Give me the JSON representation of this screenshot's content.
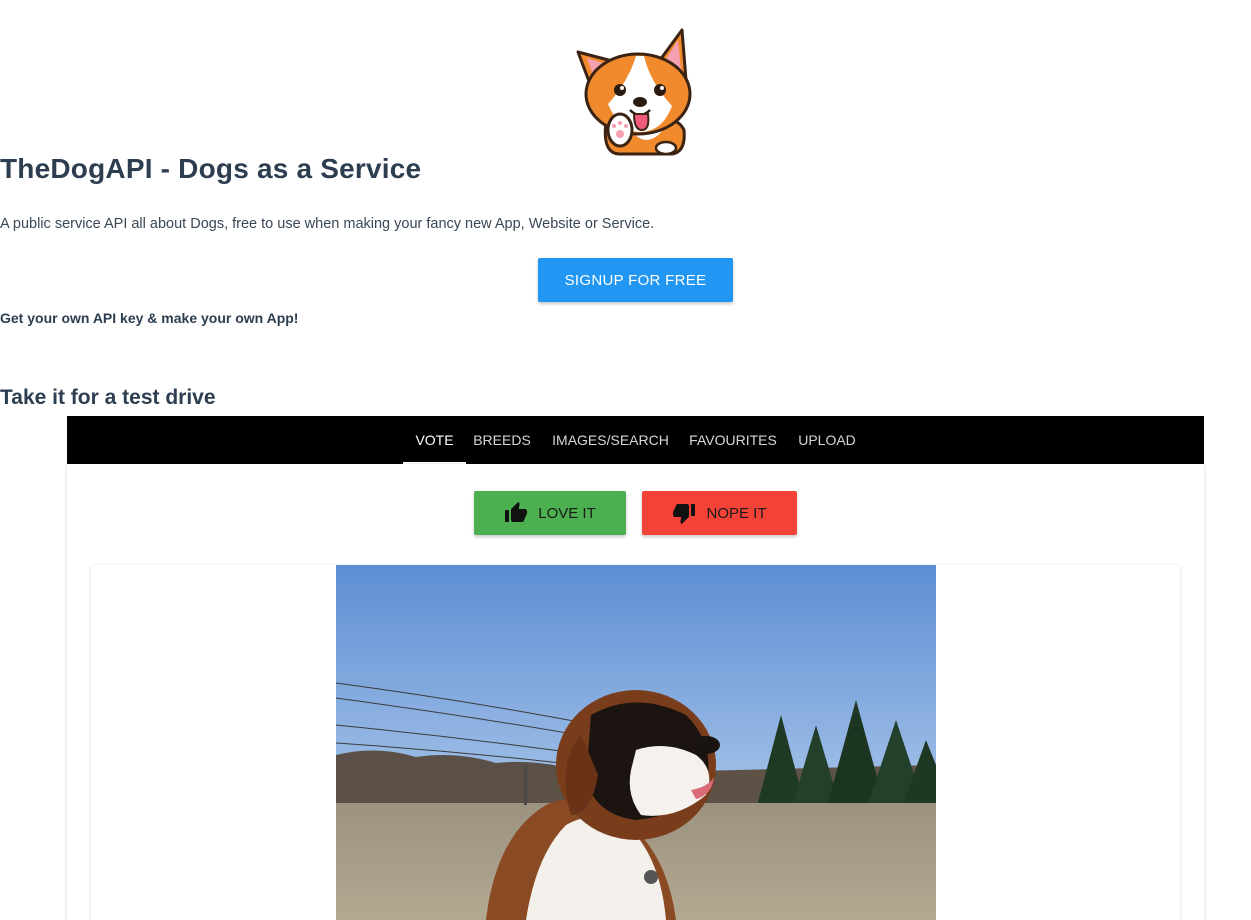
{
  "hero": {
    "title": "TheDogAPI - Dogs as a Service",
    "subtitle": "A public service API all about Dogs, free to use when making your fancy new App, Website or Service.",
    "signup_label": "SIGNUP FOR FREE",
    "apikey_text": "Get your own API key & make your own App!"
  },
  "demo": {
    "section_title": "Take it for a test drive",
    "tabs": [
      {
        "label": "VOTE",
        "active": true
      },
      {
        "label": "BREEDS",
        "active": false
      },
      {
        "label": "IMAGES/SEARCH",
        "active": false
      },
      {
        "label": "FAVOURITES",
        "active": false
      },
      {
        "label": "UPLOAD",
        "active": false
      }
    ],
    "love_label": "LOVE IT",
    "nope_label": "NOPE IT"
  },
  "colors": {
    "primary": "#2196f3",
    "love": "#4caf50",
    "nope": "#f44336",
    "tabbar": "#000000",
    "heading": "#2c3e50"
  },
  "icons": {
    "logo": "corgi-logo",
    "love": "thumbs-up-icon",
    "nope": "thumbs-down-icon"
  }
}
